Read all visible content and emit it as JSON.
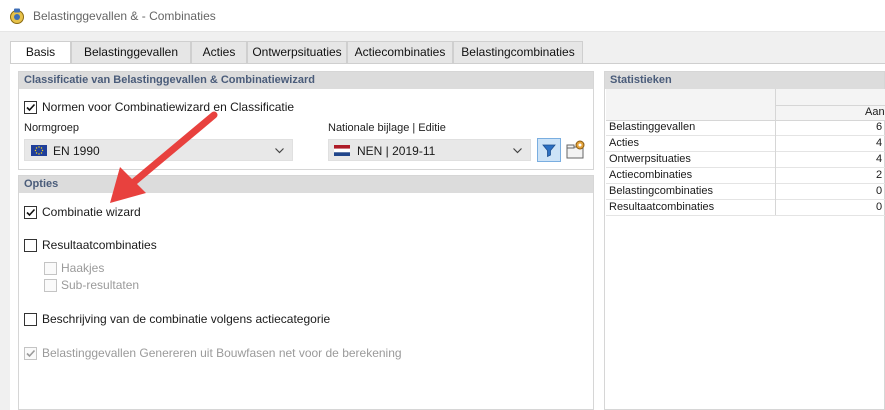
{
  "window": {
    "title": "Belastinggevallen & - Combinaties"
  },
  "tabs": [
    {
      "label": "Basis",
      "active": true
    },
    {
      "label": "Belastinggevallen",
      "active": false
    },
    {
      "label": "Acties",
      "active": false
    },
    {
      "label": "Ontwerpsituaties",
      "active": false
    },
    {
      "label": "Actiecombinaties",
      "active": false
    },
    {
      "label": "Belastingcombinaties",
      "active": false
    }
  ],
  "classification": {
    "title": "Classificatie van Belastinggevallen & Combinatiewizard",
    "norms_checkbox": {
      "label": "Normen voor Combinatiewizard en Classificatie",
      "checked": true
    },
    "normgroep": {
      "label": "Normgroep",
      "value": "EN 1990",
      "flag": "eu-flag-icon"
    },
    "annex": {
      "label": "Nationale bijlage | Editie",
      "value": "NEN | 2019-11",
      "flag": "nl-flag-icon"
    }
  },
  "options": {
    "title": "Opties",
    "combination_wizard": {
      "label": "Combinatie wizard",
      "checked": true,
      "enabled": true
    },
    "result_combinations": {
      "label": "Resultaatcombinaties",
      "checked": false,
      "enabled": true
    },
    "brackets": {
      "label": "Haakjes",
      "checked": false,
      "enabled": false
    },
    "sub_results": {
      "label": "Sub-resultaten",
      "checked": false,
      "enabled": false
    },
    "description": {
      "label": "Beschrijving van de combinatie volgens actiecategorie",
      "checked": false,
      "enabled": true
    },
    "generate": {
      "label": "Belastinggevallen Genereren uit Bouwfasen net voor de berekening",
      "checked": true,
      "enabled": false
    }
  },
  "statistics": {
    "title": "Statistieken",
    "column_header": "Aan",
    "rows": [
      {
        "name": "Belastinggevallen",
        "value": "6"
      },
      {
        "name": "Acties",
        "value": "4"
      },
      {
        "name": "Ontwerpsituaties",
        "value": "4"
      },
      {
        "name": "Actiecombinaties",
        "value": "2"
      },
      {
        "name": "Belastingcombinaties",
        "value": "0"
      },
      {
        "name": "Resultaatcombinaties",
        "value": "0"
      }
    ]
  },
  "colors": {
    "panel_title": "#4a5c7a",
    "arrow": "#e8413e",
    "filter_active": "#cde3f7"
  }
}
